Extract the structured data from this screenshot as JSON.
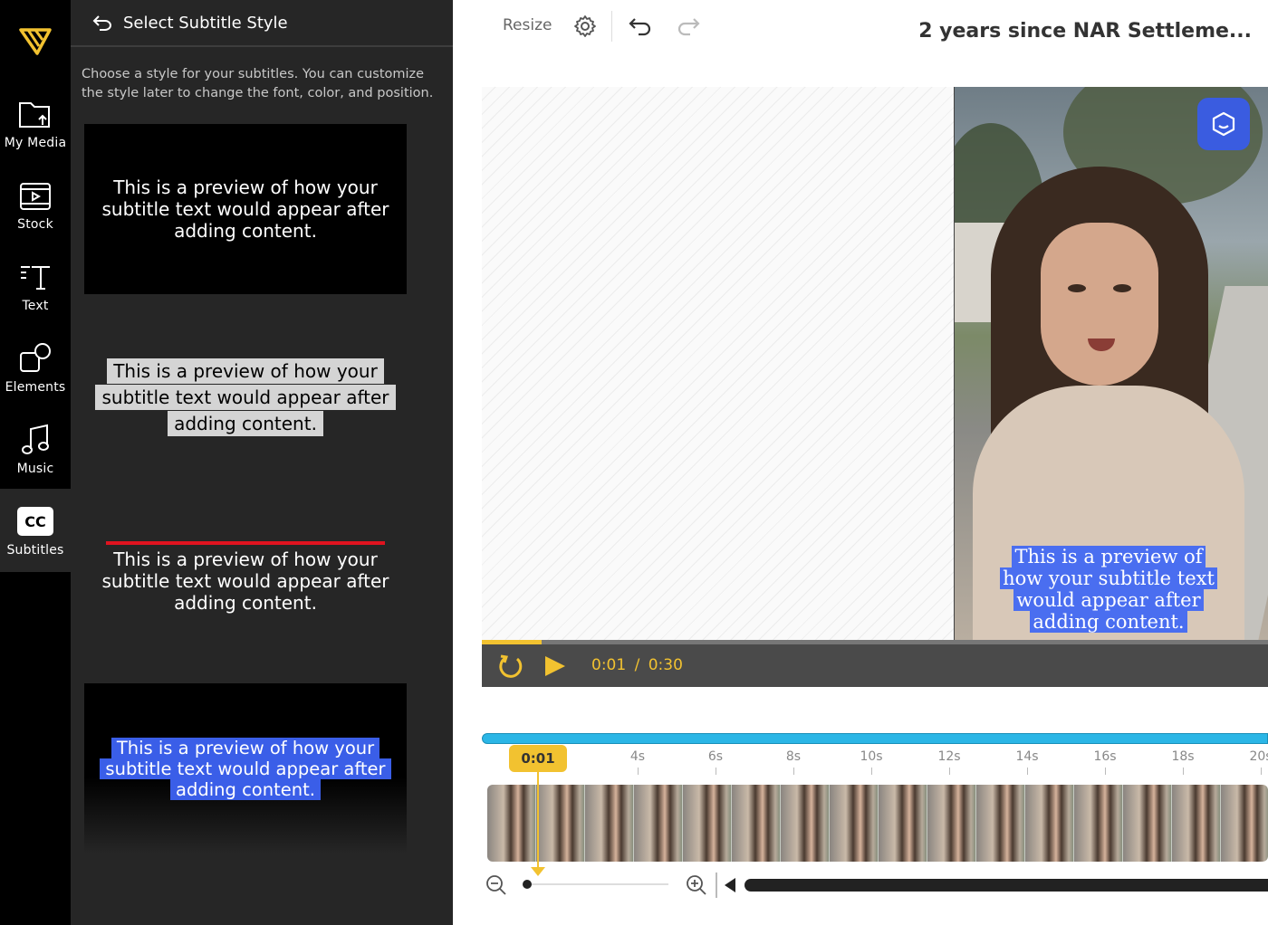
{
  "rail": {
    "items": [
      {
        "label": "My Media",
        "icon": "folder-upload-icon"
      },
      {
        "label": "Stock",
        "icon": "film-icon"
      },
      {
        "label": "Text",
        "icon": "text-icon"
      },
      {
        "label": "Elements",
        "icon": "shapes-icon"
      },
      {
        "label": "Music",
        "icon": "music-note-icon"
      },
      {
        "label": "Subtitles",
        "icon": "cc-icon",
        "active": true
      }
    ]
  },
  "panel": {
    "title": "Select Subtitle Style",
    "description": "Choose a style for your subtitles. You can customize the style later to change the font, color, and position.",
    "preview_text": "This is a preview of how your subtitle text would appear after adding content."
  },
  "topbar": {
    "resize_label": "Resize",
    "project_title": "2 years since NAR Settleme..."
  },
  "video": {
    "subtitle": "This is a preview of how your subtitle text would appear after adding content."
  },
  "player": {
    "current_time": "0:01",
    "separator": "/",
    "duration": "0:30",
    "progress_fraction": 0.076
  },
  "timeline": {
    "playhead_label": "0:01",
    "ticks": [
      "4s",
      "6s",
      "8s",
      "10s",
      "12s",
      "14s",
      "16s",
      "18s",
      "20s"
    ]
  },
  "colors": {
    "accent_yellow": "#f2c230",
    "subtitle_blue": "#3a5ee8",
    "timeline_blue": "#2bb6e6",
    "bar_red": "#e0131f"
  }
}
